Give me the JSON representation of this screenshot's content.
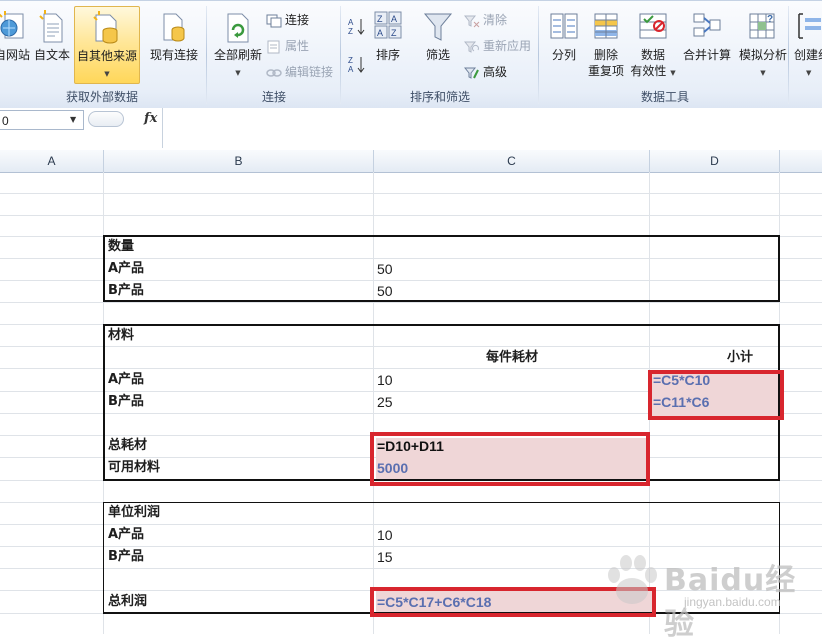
{
  "ribbon": {
    "groups": {
      "get_external": {
        "label": "获取外部数据",
        "btn_web": "自网站",
        "btn_text": "自文本",
        "btn_other": "自其他来源",
        "btn_existing": "现有连接"
      },
      "connections": {
        "label": "连接",
        "btn_refresh_all": "全部刷新",
        "btn_connections": "连接",
        "btn_properties": "属性",
        "btn_edit_links": "编辑链接"
      },
      "sort_filter": {
        "label": "排序和筛选",
        "btn_sort": "排序",
        "btn_filter": "筛选",
        "btn_clear": "清除",
        "btn_reapply": "重新应用",
        "btn_advanced": "高级"
      },
      "data_tools": {
        "label": "数据工具",
        "btn_text_to_columns": "分列",
        "btn_remove_dup_1": "删除",
        "btn_remove_dup_2": "重复项",
        "btn_validation_1": "数据",
        "btn_validation_2": "有效性",
        "btn_consolidate": "合并计算",
        "btn_whatif": "模拟分析"
      },
      "outline": {
        "btn_group": "创建组"
      }
    }
  },
  "formula_bar": {
    "name_box": "0",
    "fx": "fx",
    "content": ""
  },
  "columns": [
    "A",
    "B",
    "C",
    "D"
  ],
  "sheet": {
    "quantity_title": "数量",
    "quantity_a_label": "A产品",
    "quantity_a_value": "50",
    "quantity_b_label": "B产品",
    "quantity_b_value": "50",
    "material_title": "材料",
    "material_col_per_unit": "每件耗材",
    "material_col_subtotal": "小计",
    "material_a_label": "A产品",
    "material_a_value": "10",
    "material_a_subtotal": "=C5*C10",
    "material_b_label": "B产品",
    "material_b_value": "25",
    "material_b_subtotal": "=C11*C6",
    "total_consumption_label": "总耗材",
    "total_consumption_formula": "=D10+D11",
    "available_material_label": "可用材料",
    "available_material_value": "5000",
    "unit_profit_title": "单位利润",
    "unit_profit_a_label": "A产品",
    "unit_profit_a_value": "10",
    "unit_profit_b_label": "B产品",
    "unit_profit_b_value": "15",
    "total_profit_label": "总利润",
    "total_profit_formula": "=C5*C17+C6*C18"
  },
  "watermark": {
    "text": "Baidu经验",
    "url": "jingyan.baidu.com"
  },
  "colors": {
    "highlight_red": "#d8262e",
    "input_pink": "#efd6d7",
    "formula_blue": "#5a6fb0"
  }
}
